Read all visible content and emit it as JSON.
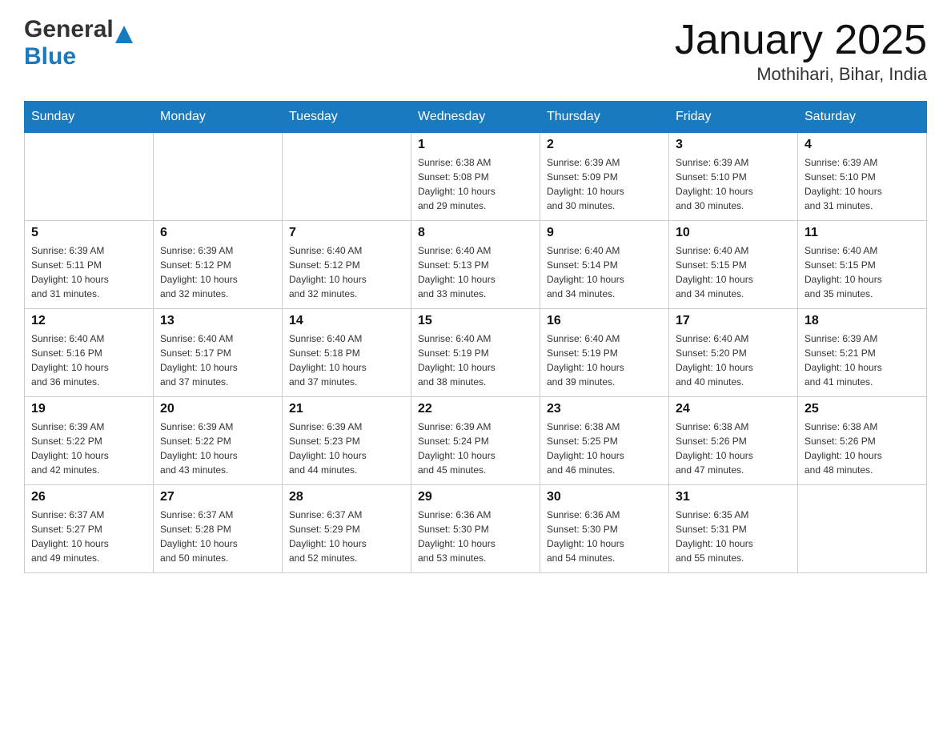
{
  "header": {
    "logo": {
      "general": "General",
      "blue": "Blue"
    },
    "title": "January 2025",
    "subtitle": "Mothihari, Bihar, India"
  },
  "calendar": {
    "headers": [
      "Sunday",
      "Monday",
      "Tuesday",
      "Wednesday",
      "Thursday",
      "Friday",
      "Saturday"
    ],
    "weeks": [
      [
        {
          "day": "",
          "info": ""
        },
        {
          "day": "",
          "info": ""
        },
        {
          "day": "",
          "info": ""
        },
        {
          "day": "1",
          "info": "Sunrise: 6:38 AM\nSunset: 5:08 PM\nDaylight: 10 hours\nand 29 minutes."
        },
        {
          "day": "2",
          "info": "Sunrise: 6:39 AM\nSunset: 5:09 PM\nDaylight: 10 hours\nand 30 minutes."
        },
        {
          "day": "3",
          "info": "Sunrise: 6:39 AM\nSunset: 5:10 PM\nDaylight: 10 hours\nand 30 minutes."
        },
        {
          "day": "4",
          "info": "Sunrise: 6:39 AM\nSunset: 5:10 PM\nDaylight: 10 hours\nand 31 minutes."
        }
      ],
      [
        {
          "day": "5",
          "info": "Sunrise: 6:39 AM\nSunset: 5:11 PM\nDaylight: 10 hours\nand 31 minutes."
        },
        {
          "day": "6",
          "info": "Sunrise: 6:39 AM\nSunset: 5:12 PM\nDaylight: 10 hours\nand 32 minutes."
        },
        {
          "day": "7",
          "info": "Sunrise: 6:40 AM\nSunset: 5:12 PM\nDaylight: 10 hours\nand 32 minutes."
        },
        {
          "day": "8",
          "info": "Sunrise: 6:40 AM\nSunset: 5:13 PM\nDaylight: 10 hours\nand 33 minutes."
        },
        {
          "day": "9",
          "info": "Sunrise: 6:40 AM\nSunset: 5:14 PM\nDaylight: 10 hours\nand 34 minutes."
        },
        {
          "day": "10",
          "info": "Sunrise: 6:40 AM\nSunset: 5:15 PM\nDaylight: 10 hours\nand 34 minutes."
        },
        {
          "day": "11",
          "info": "Sunrise: 6:40 AM\nSunset: 5:15 PM\nDaylight: 10 hours\nand 35 minutes."
        }
      ],
      [
        {
          "day": "12",
          "info": "Sunrise: 6:40 AM\nSunset: 5:16 PM\nDaylight: 10 hours\nand 36 minutes."
        },
        {
          "day": "13",
          "info": "Sunrise: 6:40 AM\nSunset: 5:17 PM\nDaylight: 10 hours\nand 37 minutes."
        },
        {
          "day": "14",
          "info": "Sunrise: 6:40 AM\nSunset: 5:18 PM\nDaylight: 10 hours\nand 37 minutes."
        },
        {
          "day": "15",
          "info": "Sunrise: 6:40 AM\nSunset: 5:19 PM\nDaylight: 10 hours\nand 38 minutes."
        },
        {
          "day": "16",
          "info": "Sunrise: 6:40 AM\nSunset: 5:19 PM\nDaylight: 10 hours\nand 39 minutes."
        },
        {
          "day": "17",
          "info": "Sunrise: 6:40 AM\nSunset: 5:20 PM\nDaylight: 10 hours\nand 40 minutes."
        },
        {
          "day": "18",
          "info": "Sunrise: 6:39 AM\nSunset: 5:21 PM\nDaylight: 10 hours\nand 41 minutes."
        }
      ],
      [
        {
          "day": "19",
          "info": "Sunrise: 6:39 AM\nSunset: 5:22 PM\nDaylight: 10 hours\nand 42 minutes."
        },
        {
          "day": "20",
          "info": "Sunrise: 6:39 AM\nSunset: 5:22 PM\nDaylight: 10 hours\nand 43 minutes."
        },
        {
          "day": "21",
          "info": "Sunrise: 6:39 AM\nSunset: 5:23 PM\nDaylight: 10 hours\nand 44 minutes."
        },
        {
          "day": "22",
          "info": "Sunrise: 6:39 AM\nSunset: 5:24 PM\nDaylight: 10 hours\nand 45 minutes."
        },
        {
          "day": "23",
          "info": "Sunrise: 6:38 AM\nSunset: 5:25 PM\nDaylight: 10 hours\nand 46 minutes."
        },
        {
          "day": "24",
          "info": "Sunrise: 6:38 AM\nSunset: 5:26 PM\nDaylight: 10 hours\nand 47 minutes."
        },
        {
          "day": "25",
          "info": "Sunrise: 6:38 AM\nSunset: 5:26 PM\nDaylight: 10 hours\nand 48 minutes."
        }
      ],
      [
        {
          "day": "26",
          "info": "Sunrise: 6:37 AM\nSunset: 5:27 PM\nDaylight: 10 hours\nand 49 minutes."
        },
        {
          "day": "27",
          "info": "Sunrise: 6:37 AM\nSunset: 5:28 PM\nDaylight: 10 hours\nand 50 minutes."
        },
        {
          "day": "28",
          "info": "Sunrise: 6:37 AM\nSunset: 5:29 PM\nDaylight: 10 hours\nand 52 minutes."
        },
        {
          "day": "29",
          "info": "Sunrise: 6:36 AM\nSunset: 5:30 PM\nDaylight: 10 hours\nand 53 minutes."
        },
        {
          "day": "30",
          "info": "Sunrise: 6:36 AM\nSunset: 5:30 PM\nDaylight: 10 hours\nand 54 minutes."
        },
        {
          "day": "31",
          "info": "Sunrise: 6:35 AM\nSunset: 5:31 PM\nDaylight: 10 hours\nand 55 minutes."
        },
        {
          "day": "",
          "info": ""
        }
      ]
    ]
  }
}
